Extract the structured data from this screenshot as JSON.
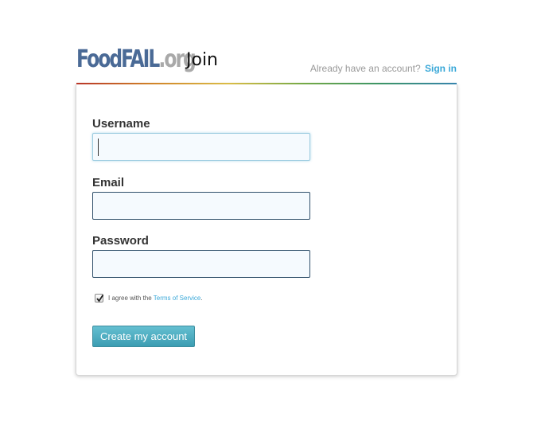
{
  "header": {
    "logo_name": "FoodFAIL",
    "logo_tld": ".org",
    "title": "Join",
    "signin_prompt": "Already have an account?",
    "signin_link": "Sign in"
  },
  "form": {
    "username": {
      "label": "Username",
      "value": ""
    },
    "email": {
      "label": "Email",
      "value": ""
    },
    "password": {
      "label": "Password",
      "value": ""
    },
    "terms": {
      "checked": true,
      "text_before": "I agree with the",
      "link": "Terms of Service",
      "text_after": "."
    },
    "submit_label": "Create my account"
  },
  "colors": {
    "brand": "#4a6a96",
    "link": "#3aa8d8",
    "button": "#4fb0c4"
  }
}
